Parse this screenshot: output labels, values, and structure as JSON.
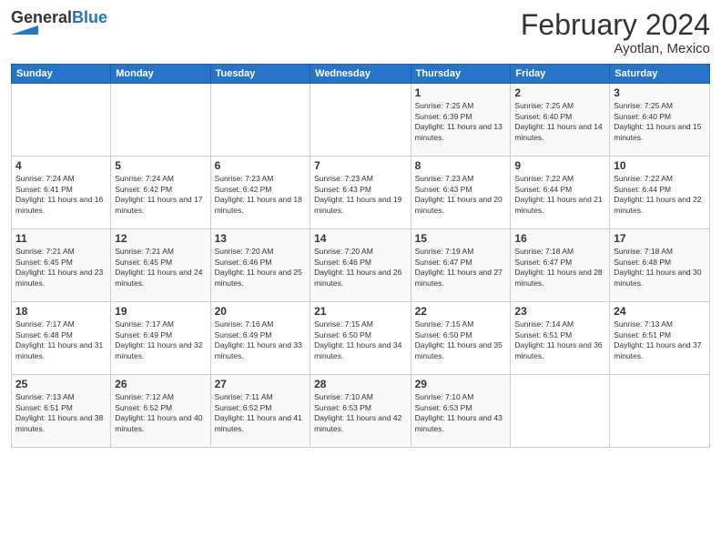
{
  "header": {
    "logo_general": "General",
    "logo_blue": "Blue",
    "month_year": "February 2024",
    "location": "Ayotlan, Mexico"
  },
  "days_of_week": [
    "Sunday",
    "Monday",
    "Tuesday",
    "Wednesday",
    "Thursday",
    "Friday",
    "Saturday"
  ],
  "weeks": [
    [
      {
        "day": "",
        "sunrise": "",
        "sunset": "",
        "daylight": ""
      },
      {
        "day": "",
        "sunrise": "",
        "sunset": "",
        "daylight": ""
      },
      {
        "day": "",
        "sunrise": "",
        "sunset": "",
        "daylight": ""
      },
      {
        "day": "",
        "sunrise": "",
        "sunset": "",
        "daylight": ""
      },
      {
        "day": "1",
        "sunrise": "7:25 AM",
        "sunset": "6:39 PM",
        "daylight": "11 hours and 13 minutes."
      },
      {
        "day": "2",
        "sunrise": "7:25 AM",
        "sunset": "6:40 PM",
        "daylight": "11 hours and 14 minutes."
      },
      {
        "day": "3",
        "sunrise": "7:25 AM",
        "sunset": "6:40 PM",
        "daylight": "11 hours and 15 minutes."
      }
    ],
    [
      {
        "day": "4",
        "sunrise": "7:24 AM",
        "sunset": "6:41 PM",
        "daylight": "11 hours and 16 minutes."
      },
      {
        "day": "5",
        "sunrise": "7:24 AM",
        "sunset": "6:42 PM",
        "daylight": "11 hours and 17 minutes."
      },
      {
        "day": "6",
        "sunrise": "7:23 AM",
        "sunset": "6:42 PM",
        "daylight": "11 hours and 18 minutes."
      },
      {
        "day": "7",
        "sunrise": "7:23 AM",
        "sunset": "6:43 PM",
        "daylight": "11 hours and 19 minutes."
      },
      {
        "day": "8",
        "sunrise": "7:23 AM",
        "sunset": "6:43 PM",
        "daylight": "11 hours and 20 minutes."
      },
      {
        "day": "9",
        "sunrise": "7:22 AM",
        "sunset": "6:44 PM",
        "daylight": "11 hours and 21 minutes."
      },
      {
        "day": "10",
        "sunrise": "7:22 AM",
        "sunset": "6:44 PM",
        "daylight": "11 hours and 22 minutes."
      }
    ],
    [
      {
        "day": "11",
        "sunrise": "7:21 AM",
        "sunset": "6:45 PM",
        "daylight": "11 hours and 23 minutes."
      },
      {
        "day": "12",
        "sunrise": "7:21 AM",
        "sunset": "6:45 PM",
        "daylight": "11 hours and 24 minutes."
      },
      {
        "day": "13",
        "sunrise": "7:20 AM",
        "sunset": "6:46 PM",
        "daylight": "11 hours and 25 minutes."
      },
      {
        "day": "14",
        "sunrise": "7:20 AM",
        "sunset": "6:46 PM",
        "daylight": "11 hours and 26 minutes."
      },
      {
        "day": "15",
        "sunrise": "7:19 AM",
        "sunset": "6:47 PM",
        "daylight": "11 hours and 27 minutes."
      },
      {
        "day": "16",
        "sunrise": "7:18 AM",
        "sunset": "6:47 PM",
        "daylight": "11 hours and 28 minutes."
      },
      {
        "day": "17",
        "sunrise": "7:18 AM",
        "sunset": "6:48 PM",
        "daylight": "11 hours and 30 minutes."
      }
    ],
    [
      {
        "day": "18",
        "sunrise": "7:17 AM",
        "sunset": "6:48 PM",
        "daylight": "11 hours and 31 minutes."
      },
      {
        "day": "19",
        "sunrise": "7:17 AM",
        "sunset": "6:49 PM",
        "daylight": "11 hours and 32 minutes."
      },
      {
        "day": "20",
        "sunrise": "7:16 AM",
        "sunset": "6:49 PM",
        "daylight": "11 hours and 33 minutes."
      },
      {
        "day": "21",
        "sunrise": "7:15 AM",
        "sunset": "6:50 PM",
        "daylight": "11 hours and 34 minutes."
      },
      {
        "day": "22",
        "sunrise": "7:15 AM",
        "sunset": "6:50 PM",
        "daylight": "11 hours and 35 minutes."
      },
      {
        "day": "23",
        "sunrise": "7:14 AM",
        "sunset": "6:51 PM",
        "daylight": "11 hours and 36 minutes."
      },
      {
        "day": "24",
        "sunrise": "7:13 AM",
        "sunset": "6:51 PM",
        "daylight": "11 hours and 37 minutes."
      }
    ],
    [
      {
        "day": "25",
        "sunrise": "7:13 AM",
        "sunset": "6:51 PM",
        "daylight": "11 hours and 38 minutes."
      },
      {
        "day": "26",
        "sunrise": "7:12 AM",
        "sunset": "6:52 PM",
        "daylight": "11 hours and 40 minutes."
      },
      {
        "day": "27",
        "sunrise": "7:11 AM",
        "sunset": "6:52 PM",
        "daylight": "11 hours and 41 minutes."
      },
      {
        "day": "28",
        "sunrise": "7:10 AM",
        "sunset": "6:53 PM",
        "daylight": "11 hours and 42 minutes."
      },
      {
        "day": "29",
        "sunrise": "7:10 AM",
        "sunset": "6:53 PM",
        "daylight": "11 hours and 43 minutes."
      },
      {
        "day": "",
        "sunrise": "",
        "sunset": "",
        "daylight": ""
      },
      {
        "day": "",
        "sunrise": "",
        "sunset": "",
        "daylight": ""
      }
    ]
  ],
  "labels": {
    "sunrise": "Sunrise:",
    "sunset": "Sunset:",
    "daylight": "Daylight:"
  }
}
